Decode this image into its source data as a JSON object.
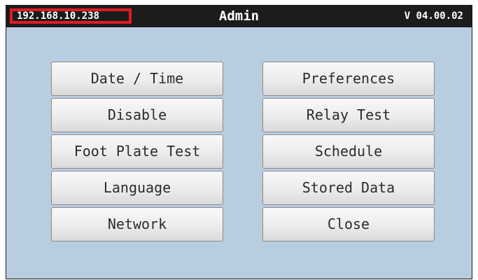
{
  "header": {
    "ip_address": "192.168.10.238",
    "title": "Admin",
    "version": "V 04.00.02"
  },
  "buttons": {
    "left": [
      "Date / Time",
      "Disable",
      "Foot Plate Test",
      "Language",
      "Network"
    ],
    "right": [
      "Preferences",
      "Relay Test",
      "Schedule",
      "Stored Data",
      "Close"
    ]
  },
  "colors": {
    "background": "#b9cde0",
    "titlebar": "#1c1c1c",
    "highlight": "#e11b22"
  }
}
